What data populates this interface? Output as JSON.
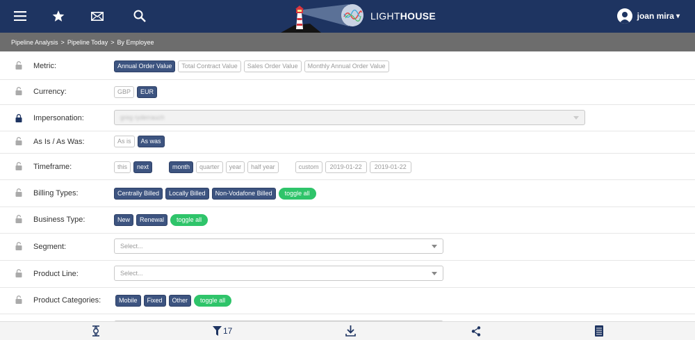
{
  "header": {
    "logo_light": "LIGHT",
    "logo_house": "HOUSE",
    "user_name": "joan mira",
    "user_caret": "▾"
  },
  "breadcrumb": [
    "Pipeline Analysis",
    ">",
    "Pipeline Today",
    ">",
    "By Employee"
  ],
  "rows": {
    "metric": {
      "label": "Metric:",
      "options": [
        "Annual Order Value",
        "Total Contract Value",
        "Sales Order Value",
        "Monthly Annual Order Value"
      ]
    },
    "currency": {
      "label": "Currency:",
      "options": [
        "GBP",
        "EUR"
      ]
    },
    "impersonation": {
      "label": "Impersonation:",
      "value": "greg ryderrauch"
    },
    "asis": {
      "label": "As Is / As Was:",
      "options": [
        "As is",
        "As was"
      ]
    },
    "timeframe": {
      "label": "Timeframe:",
      "options": [
        "this",
        "next",
        "month",
        "quarter",
        "year",
        "half year",
        "custom",
        "2019-01-22",
        "2019-01-22"
      ]
    },
    "billing": {
      "label": "Billing Types:",
      "options": [
        "Centrally Billed",
        "Locally Billed",
        "Non-Vodafone Billed"
      ],
      "toggle": "toggle all"
    },
    "business": {
      "label": "Business Type:",
      "options": [
        "New",
        "Renewal"
      ],
      "toggle": "toggle all"
    },
    "segment": {
      "label": "Segment:",
      "placeholder": "Select..."
    },
    "productline": {
      "label": "Product Line:",
      "placeholder": "Select..."
    },
    "categories": {
      "label": "Product Categories:",
      "options": [
        "Mobile",
        "Fixed",
        "Other"
      ],
      "toggle": "toggle all"
    }
  },
  "bottombar": {
    "filter_count": "17"
  },
  "colors": {
    "navy": "#1e3461",
    "selected": "#3d5480",
    "toggle": "#2fc46a",
    "breadcrumb_bg": "#6d6d6d"
  }
}
